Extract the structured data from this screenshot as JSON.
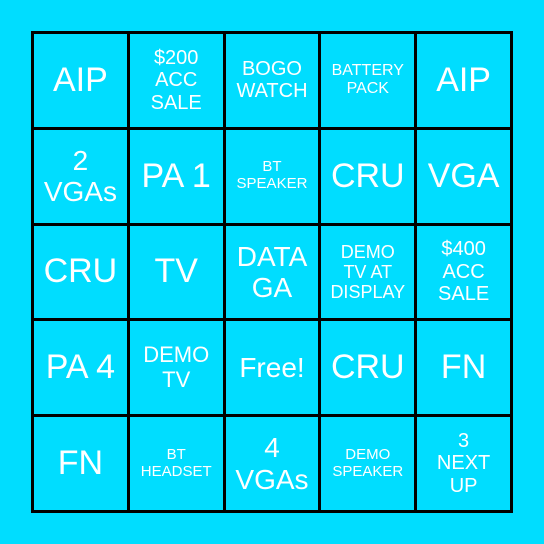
{
  "card": {
    "background_color": "#00DDFF",
    "text_color": "#FFFFFF",
    "grid_line_color": "#000000",
    "rows": [
      [
        "AIP",
        "$200\nACC\nSALE",
        "BOGO\nWATCH",
        "BATTERY\nPACK",
        "AIP"
      ],
      [
        "2\nVGAs",
        "PA 1",
        "BT\nSPEAKER",
        "CRU",
        "VGA"
      ],
      [
        "CRU",
        "TV",
        "DATA\nGA",
        "DEMO\nTV AT\nDISPLAY",
        "$400\nACC\nSALE"
      ],
      [
        "PA 4",
        "DEMO\nTV",
        "Free!",
        "CRU",
        "FN"
      ],
      [
        "FN",
        "BT\nHEADSET",
        "4\nVGAs",
        "DEMO\nSPEAKER",
        "3\nNEXT\nUP"
      ]
    ]
  }
}
